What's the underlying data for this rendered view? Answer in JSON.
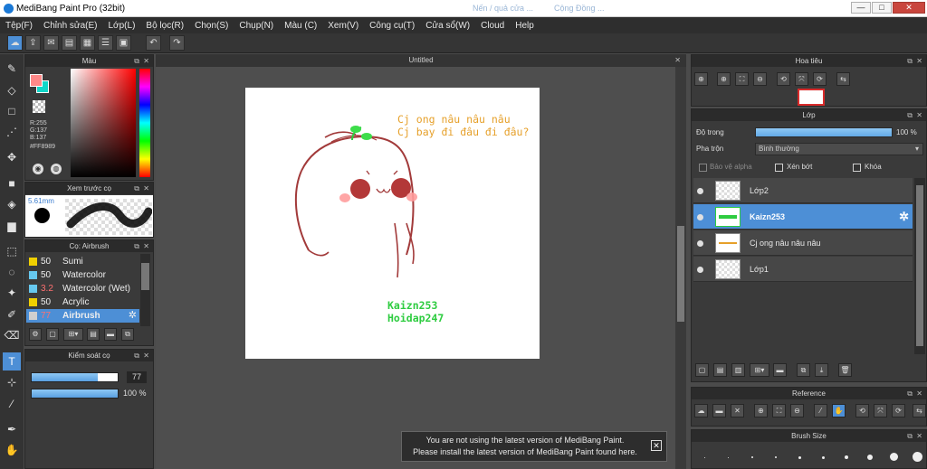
{
  "window": {
    "title": "MediBang Paint Pro (32bit)",
    "background_tabs": [
      "Nến / quả cửa ...",
      "Cộng Đồng ..."
    ],
    "controls": {
      "minimize": "—",
      "maximize": "□",
      "close": "✕"
    }
  },
  "menu": [
    "Tệp(F)",
    "Chỉnh sửa(E)",
    "Lớp(L)",
    "Bộ lọc(R)",
    "Chọn(S)",
    "Chụp(N)",
    "Màu (C)",
    "Xem(V)",
    "Công cụ(T)",
    "Cửa sổ(W)",
    "Cloud",
    "Help"
  ],
  "toolbar_icons": [
    "cloud-icon",
    "share-icon",
    "comment-icon",
    "document-icon",
    "page-icon",
    "page-list-icon",
    "grid-icon",
    "undo-icon",
    "redo-icon"
  ],
  "tools": [
    "brush-icon",
    "eraser-icon",
    "rectangle-icon",
    "dot-brush-icon",
    "move-icon",
    "fill-rect-icon",
    "bucket-icon",
    "gradient-icon",
    "select-rect-icon",
    "lasso-icon",
    "magic-wand-icon",
    "select-pen-icon",
    "select-eraser-icon",
    "text-icon",
    "divide-icon",
    "eyedropper-icon",
    "hand-icon"
  ],
  "active_tool": "text-icon",
  "color_panel": {
    "title": "Màu",
    "r_label": "R:255",
    "g_label": "G:137",
    "b_label": "B:137",
    "hex_label": "#FF8989",
    "fg_color": "#ff8989",
    "bg_color": "#11d7c9"
  },
  "brush_preview": {
    "title": "Xem trước cọ",
    "size_label": "5.61mm"
  },
  "brush_panel": {
    "title": "Cọ: Airbrush",
    "items": [
      {
        "value": "50",
        "name": "Sumi",
        "color": "#f0d000"
      },
      {
        "value": "50",
        "name": "Watercolor",
        "color": "#66c8ef"
      },
      {
        "value": "3.2",
        "name": "Watercolor (Wet)",
        "color": "#66c8ef"
      },
      {
        "value": "50",
        "name": "Acrylic",
        "color": "#f0d000"
      },
      {
        "value": "77",
        "name": "Airbrush",
        "color": "#cfcfcf"
      }
    ],
    "selected": "Airbrush"
  },
  "brush_control": {
    "title": "Kiểm soát cọ",
    "size_value": "77",
    "opacity_value": "100 %",
    "size_fraction": 0.77,
    "opacity_fraction": 1.0
  },
  "canvas": {
    "tab_title": "Untitled",
    "text_line1": "Cj ong nâu nâu nâu",
    "text_line2": "Cj bay đi đâu  đi đâu?",
    "signature_line1": "Kaizn253",
    "signature_line2": "Hoidap247"
  },
  "notice": {
    "line1": "You are not using the latest version of MediBang Paint.",
    "line2": "Please install the latest version of MediBang Paint found here."
  },
  "navigator": {
    "title": "Hoa tiêu"
  },
  "layer_panel": {
    "title": "Lớp",
    "opacity_label": "Độ trong",
    "opacity_value": "100 %",
    "blend_label": "Pha trộn",
    "blend_value": "Bình thường",
    "protect_alpha": "Bảo vệ alpha",
    "clipping": "Xén bớt",
    "lock": "Khóa",
    "layers": [
      {
        "name": "Lớp2",
        "selected": false
      },
      {
        "name": "Kaizn253",
        "selected": true
      },
      {
        "name": "Cj ong nâu nâu nâu",
        "selected": false
      },
      {
        "name": "Lớp1",
        "selected": false
      }
    ]
  },
  "reference_panel": {
    "title": "Reference"
  },
  "brush_size_panel": {
    "title": "Brush Size"
  },
  "colors": {
    "accent": "#4d8fd6",
    "panel": "#3a3a3a",
    "canvas_bg": "#4e4e4e"
  }
}
